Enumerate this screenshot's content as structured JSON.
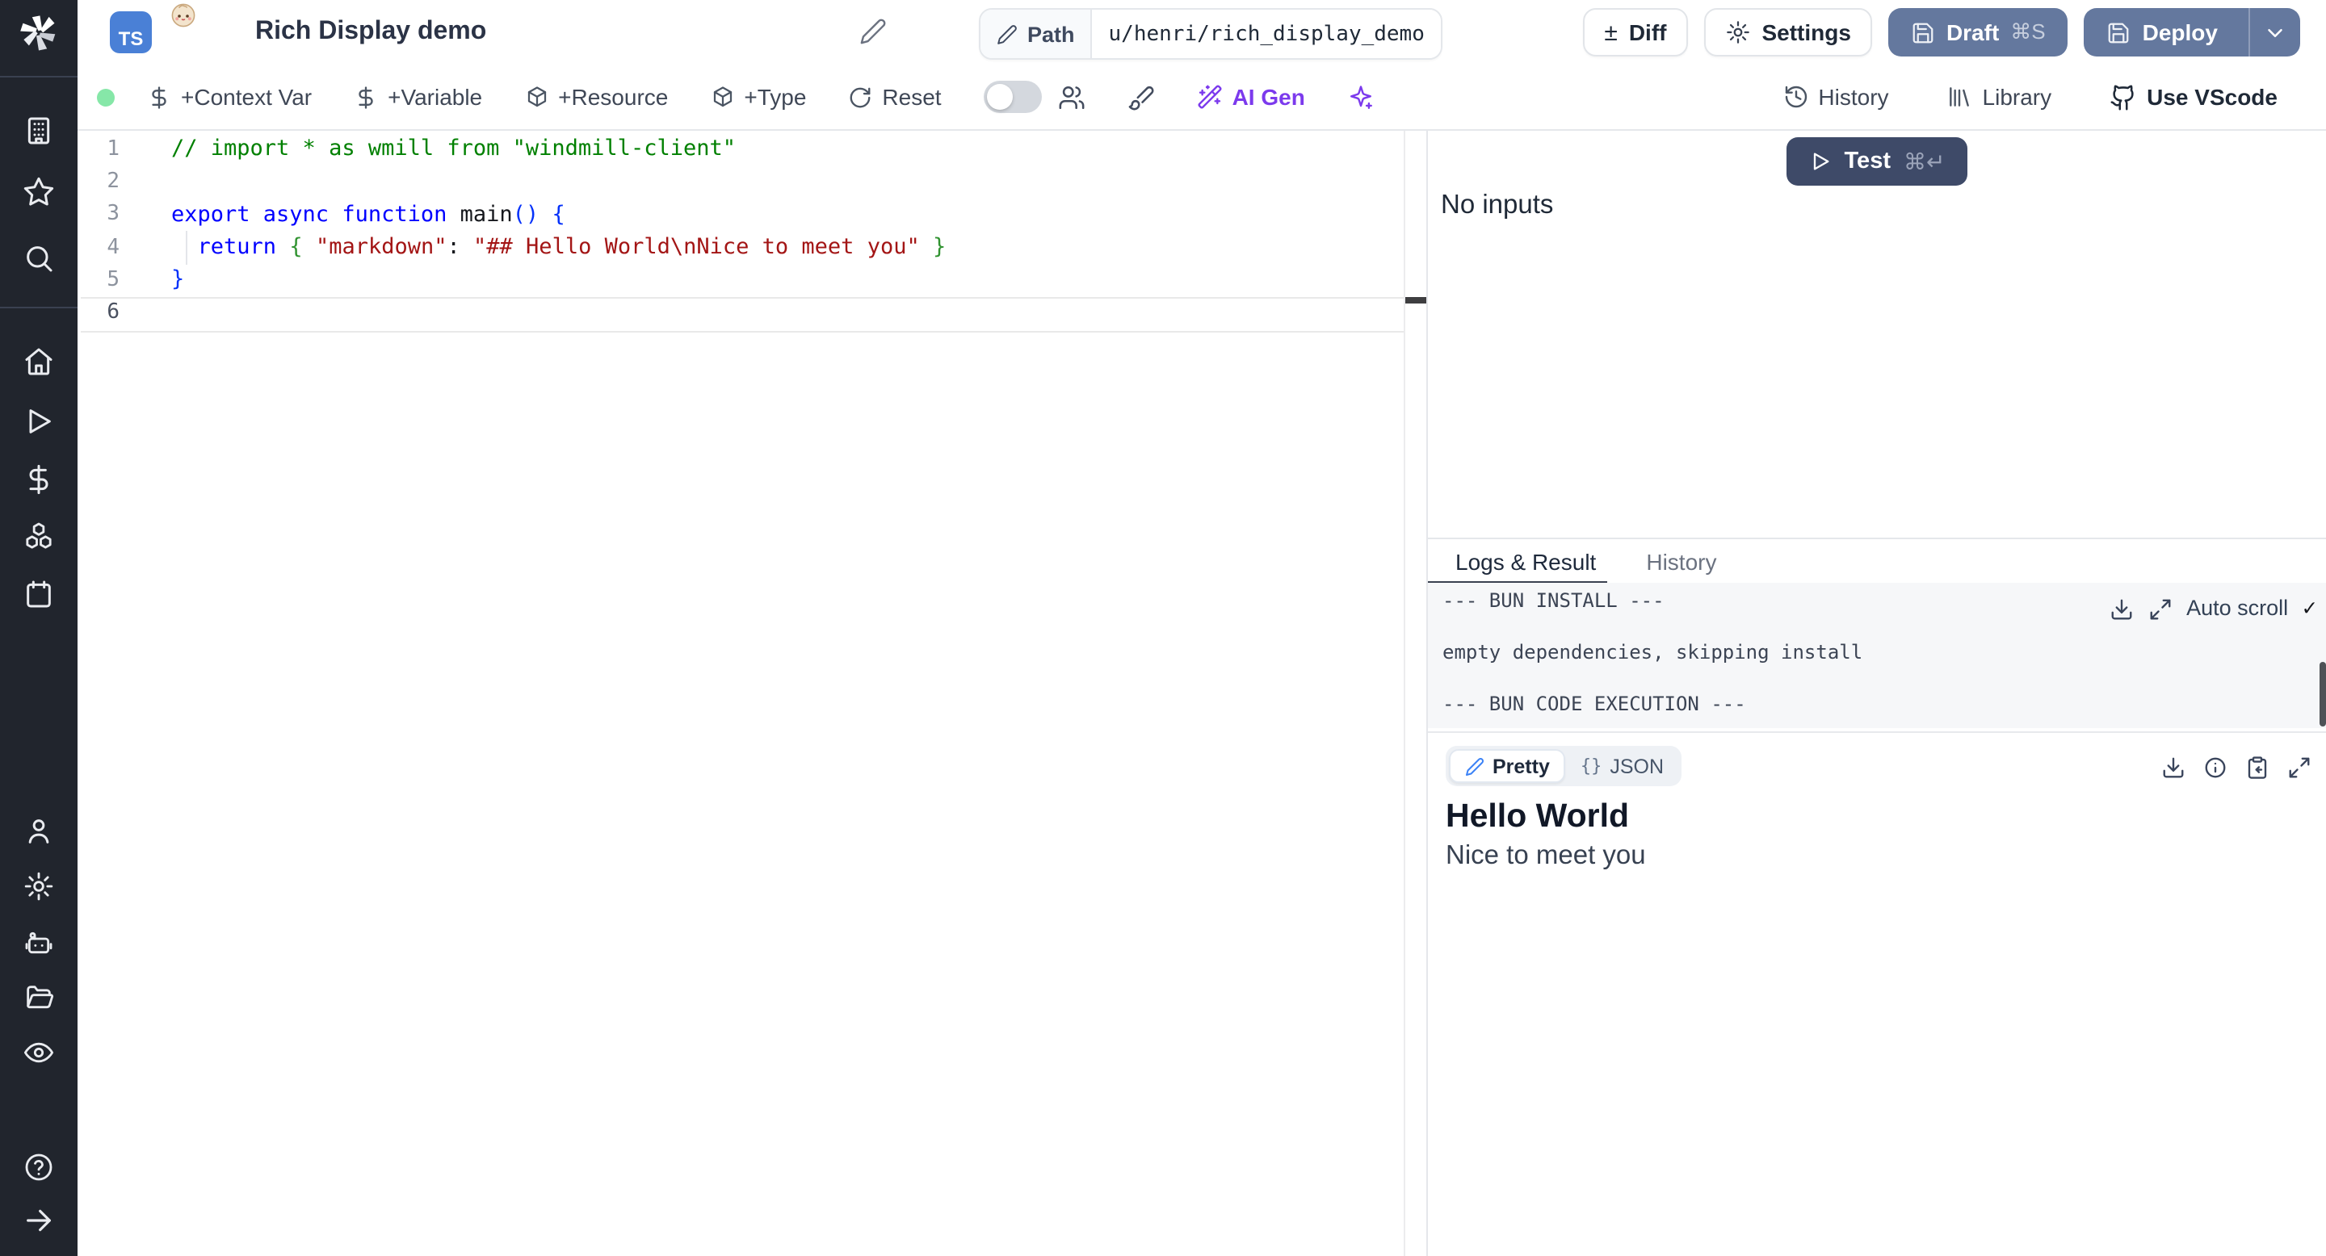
{
  "header": {
    "lang_badge": "TS",
    "title": "Rich Display demo",
    "path_label": "Path",
    "path_value": "u/henri/rich_display_demo",
    "diff_glyph": "±",
    "diff_label": "Diff",
    "settings_label": "Settings",
    "draft_label": "Draft",
    "draft_shortcut": "⌘S",
    "deploy_label": "Deploy"
  },
  "toolbar": {
    "context_var": "+Context Var",
    "variable": "+Variable",
    "resource": "+Resource",
    "type": "+Type",
    "reset": "Reset",
    "ai_gen": "AI Gen",
    "history": "History",
    "library": "Library",
    "use_vscode": "Use VScode"
  },
  "editor": {
    "lines": [
      {
        "n": "1",
        "active": false,
        "tokens": [
          {
            "t": "// import * as wmill from \"windmill-client\"",
            "s": "comment"
          }
        ]
      },
      {
        "n": "2",
        "active": false,
        "tokens": []
      },
      {
        "n": "3",
        "active": false,
        "tokens": [
          {
            "t": "export async function ",
            "s": "kw"
          },
          {
            "t": "main",
            "s": "fn"
          },
          {
            "t": "()",
            "s": "b1"
          },
          {
            "t": " ",
            "s": "pl"
          },
          {
            "t": "{",
            "s": "b1"
          }
        ]
      },
      {
        "n": "4",
        "active": false,
        "tokens": [
          {
            "t": "  ",
            "s": "pl"
          },
          {
            "t": "return",
            "s": "kw"
          },
          {
            "t": " ",
            "s": "pl"
          },
          {
            "t": "{",
            "s": "b2"
          },
          {
            "t": " ",
            "s": "pl"
          },
          {
            "t": "\"markdown\"",
            "s": "str"
          },
          {
            "t": ": ",
            "s": "pl"
          },
          {
            "t": "\"## Hello World\\nNice to meet you\"",
            "s": "str"
          },
          {
            "t": " ",
            "s": "pl"
          },
          {
            "t": "}",
            "s": "b2"
          }
        ]
      },
      {
        "n": "5",
        "active": false,
        "tokens": [
          {
            "t": "}",
            "s": "b1"
          }
        ]
      },
      {
        "n": "6",
        "active": true,
        "tokens": []
      }
    ]
  },
  "run_panel": {
    "test_label": "Test",
    "test_shortcut": "⌘↵",
    "no_inputs": "No inputs"
  },
  "logs_panel": {
    "tab_logs": "Logs & Result",
    "tab_history": "History",
    "auto_scroll": "Auto scroll",
    "check_glyph": "✓",
    "lines": [
      "--- BUN INSTALL ---",
      "",
      "empty dependencies, skipping install",
      "",
      "--- BUN CODE EXECUTION ---"
    ]
  },
  "result_panel": {
    "pretty_label": "Pretty",
    "json_braces": "{}",
    "json_label": "JSON",
    "heading": "Hello World",
    "body": "Nice to meet you"
  },
  "icons": {
    "sidebar": [
      "windmill-logo",
      "buildings-icon",
      "star-icon",
      "search-icon",
      "home-icon",
      "play-icon",
      "dollar-icon",
      "boxes-icon",
      "calendar-icon",
      "user-icon",
      "gear-icon",
      "robot-icon",
      "folder-open-icon",
      "eye-icon",
      "help-icon",
      "arrow-right-icon"
    ],
    "toolbar": [
      "dollar-icon",
      "package-icon",
      "refresh-icon",
      "toggle",
      "users-icon",
      "paintbrush-icon",
      "wand-icon",
      "sparkles-icon",
      "clock-history-icon",
      "library-icon",
      "github-icon"
    ],
    "panels": [
      "play-icon",
      "download-icon",
      "expand-icon",
      "info-icon",
      "clipboard-icon",
      "pen-icon"
    ]
  },
  "colors": {
    "sidebar_bg": "#21252d",
    "ts_blue": "#4a80d6",
    "primary_button": "#64789e",
    "accent_dark_button": "#3e4a68",
    "ai_accent": "#7c3aed",
    "green_dot": "#86e7a8",
    "border": "#e5e7eb",
    "logs_bg": "#f6f7f9",
    "code_comment": "#008000",
    "code_keyword": "#0000ff",
    "code_string": "#a31515",
    "code_bracket1": "#0431fa",
    "code_bracket2": "#319331"
  }
}
